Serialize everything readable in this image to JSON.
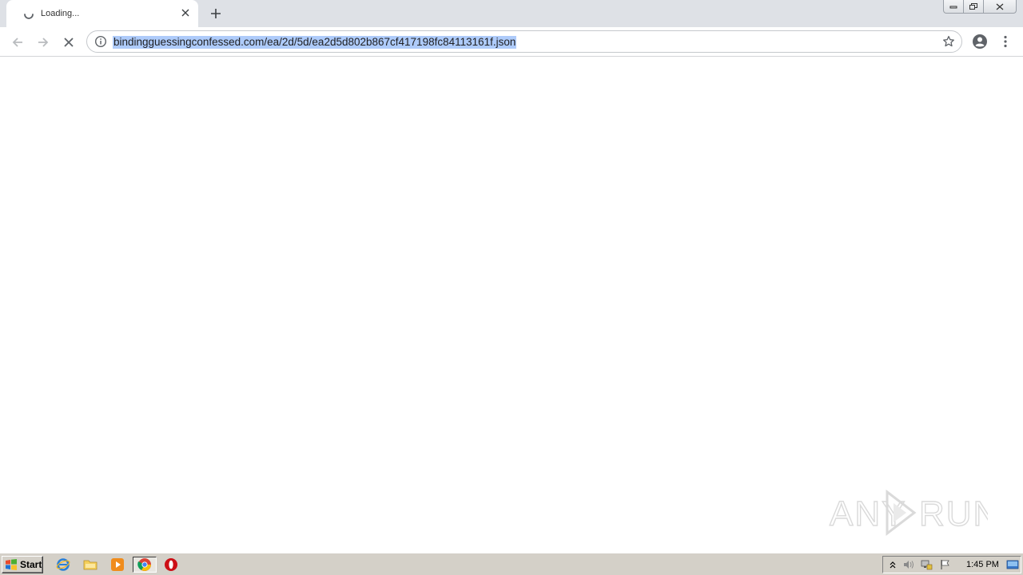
{
  "browser": {
    "tab": {
      "title": "Loading...",
      "loading": true
    },
    "address_bar": {
      "url": "bindingguessingconfessed.com/ea/2d/5d/ea2d5d802b867cf417198fc84113161f.json",
      "selected": true
    },
    "icons": {
      "back": "back-arrow-icon",
      "forward": "forward-arrow-icon",
      "stop": "stop-x-icon",
      "info": "info-icon",
      "bookmark": "star-icon",
      "profile": "account-icon",
      "menu": "kebab-menu-icon"
    },
    "colors": {
      "tabstrip": "#dee1e6",
      "url_selection": "#aecbfa"
    }
  },
  "content": {
    "watermark": "ANY RUN"
  },
  "taskbar": {
    "start_label": "Start",
    "pinned": [
      "internet-explorer-icon",
      "file-explorer-icon",
      "media-player-icon",
      "chrome-icon",
      "opera-icon"
    ],
    "clock": "1:45 PM"
  }
}
